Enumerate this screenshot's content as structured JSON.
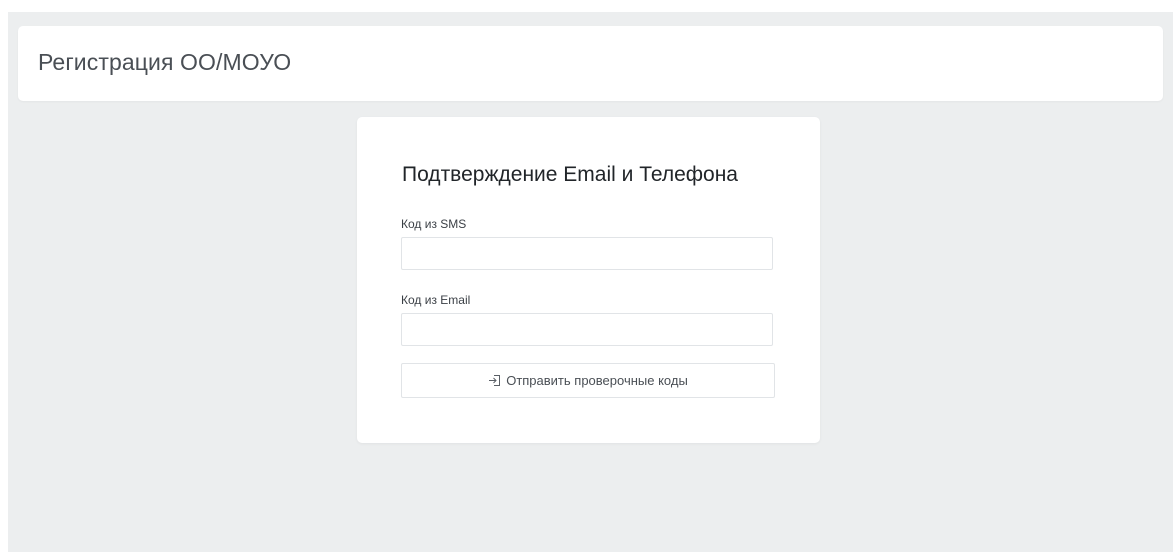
{
  "header": {
    "title": "Регистрация ОО/МОУО"
  },
  "form": {
    "title": "Подтверждение Email и Телефона",
    "sms_code": {
      "label": "Код из SMS",
      "value": "",
      "placeholder": ""
    },
    "email_code": {
      "label": "Код из Email",
      "value": "",
      "placeholder": ""
    },
    "submit": {
      "label": "Отправить проверочные коды",
      "icon": "sign-in-icon"
    }
  },
  "colors": {
    "page_background": "#eceeef",
    "card_background": "#ffffff",
    "input_border": "#e1e4e7",
    "text": "#212529"
  }
}
